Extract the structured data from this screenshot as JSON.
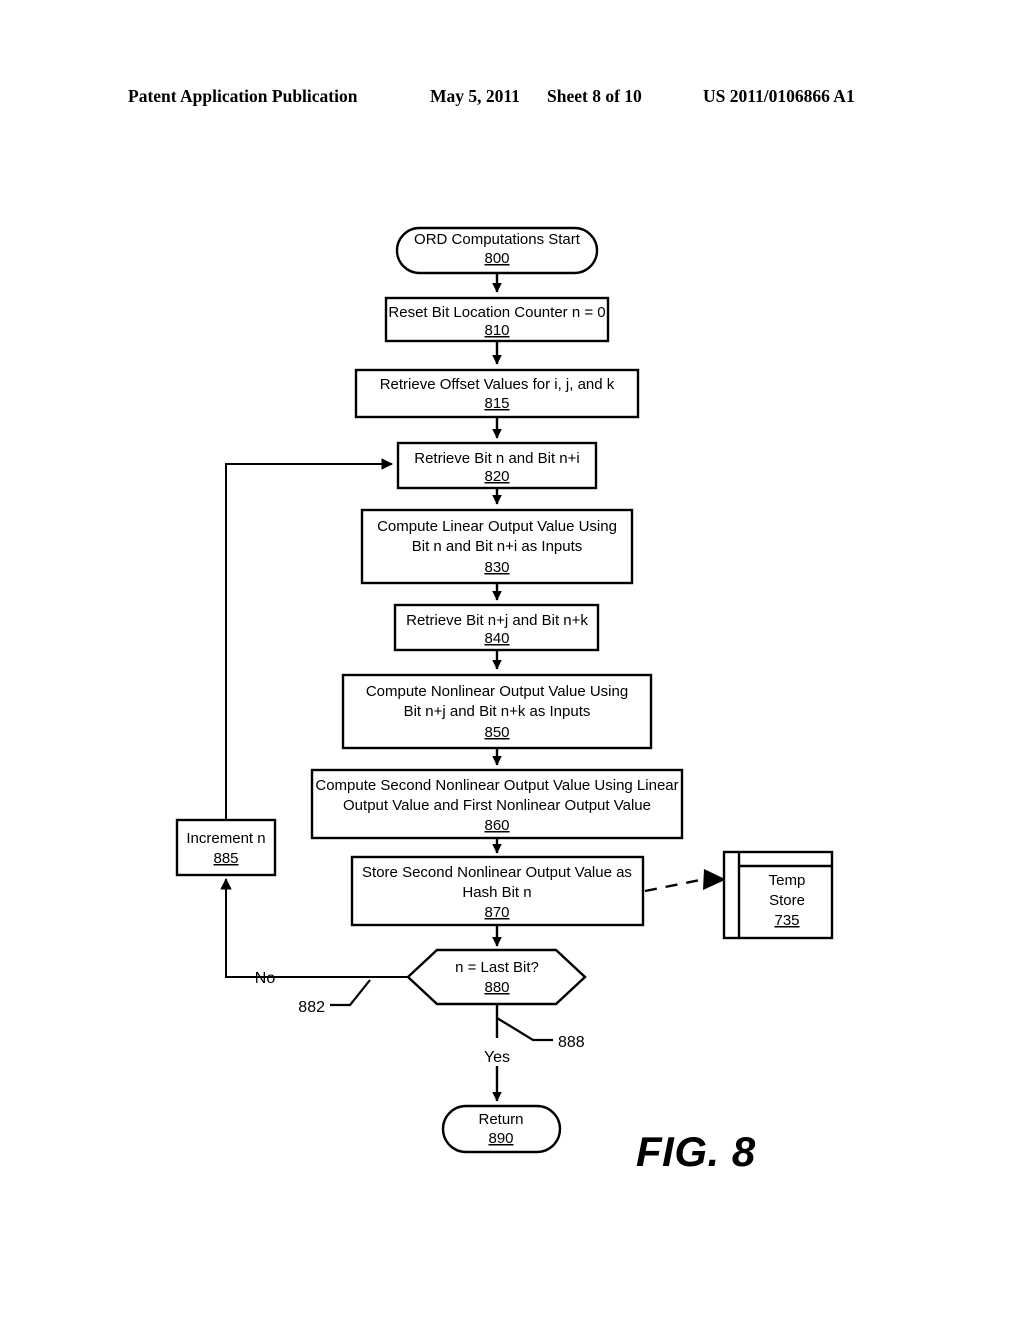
{
  "header": {
    "publication": "Patent Application Publication",
    "date": "May 5, 2011",
    "sheet": "Sheet 8 of 10",
    "number": "US 2011/0106866 A1"
  },
  "figure": {
    "label": "FIG. 8"
  },
  "flowchart": {
    "nodes": [
      {
        "id": "800",
        "shape": "terminator",
        "lines": [
          "ORD Computations Start"
        ],
        "ref": "800"
      },
      {
        "id": "810",
        "shape": "process",
        "lines": [
          "Reset Bit Location Counter n = 0"
        ],
        "ref": "810"
      },
      {
        "id": "815",
        "shape": "process",
        "lines": [
          "Retrieve Offset Values for i, j, and k"
        ],
        "ref": "815"
      },
      {
        "id": "820",
        "shape": "process",
        "lines": [
          "Retrieve Bit n and Bit n+i"
        ],
        "ref": "820"
      },
      {
        "id": "830",
        "shape": "process",
        "lines": [
          "Compute Linear Output Value Using",
          "Bit n and Bit n+i as Inputs"
        ],
        "ref": "830"
      },
      {
        "id": "840",
        "shape": "process",
        "lines": [
          "Retrieve Bit n+j and Bit n+k"
        ],
        "ref": "840"
      },
      {
        "id": "850",
        "shape": "process",
        "lines": [
          "Compute Nonlinear Output Value Using",
          "Bit n+j and Bit n+k as Inputs"
        ],
        "ref": "850"
      },
      {
        "id": "860",
        "shape": "process",
        "lines": [
          "Compute Second Nonlinear Output Value Using Linear",
          "Output Value and First Nonlinear Output Value"
        ],
        "ref": "860"
      },
      {
        "id": "870",
        "shape": "process",
        "lines": [
          "Store Second Nonlinear Output Value as",
          "Hash Bit n"
        ],
        "ref": "870"
      },
      {
        "id": "880",
        "shape": "decision",
        "lines": [
          "n = Last Bit?"
        ],
        "ref": "880"
      },
      {
        "id": "885",
        "shape": "process",
        "lines": [
          "Increment n"
        ],
        "ref": "885"
      },
      {
        "id": "890",
        "shape": "terminator",
        "lines": [
          "Return"
        ],
        "ref": "890"
      },
      {
        "id": "735",
        "shape": "datastore",
        "lines": [
          "Temp",
          "Store"
        ],
        "ref": "735"
      }
    ],
    "edge_labels": {
      "no": "No",
      "yes": "Yes"
    },
    "leaders": {
      "no_branch": "882",
      "yes_branch": "888"
    }
  }
}
